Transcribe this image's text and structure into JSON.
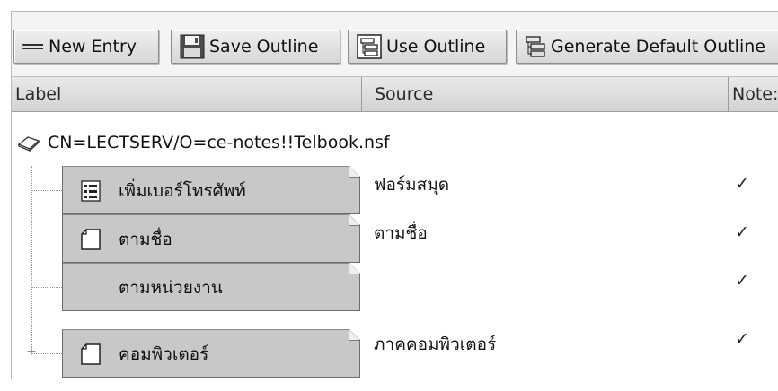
{
  "toolbar": {
    "new_entry": "New Entry",
    "save_outline": "Save Outline",
    "use_outline": "Use Outline",
    "generate_default_outline": "Generate Default Outline"
  },
  "columns": {
    "label": "Label",
    "source": "Source",
    "notes": "Note:"
  },
  "root": {
    "label": "CN=LECTSERV/O=ce-notes!!Telbook.nsf",
    "icon": "database-icon"
  },
  "entries": [
    {
      "label": "เพิ่มเบอร์โทรศัพท์",
      "icon": "form-icon",
      "source": "ฟอร์มสมุด",
      "check": "✓"
    },
    {
      "label": "ตามชื่อ",
      "icon": "page-icon",
      "source": "ตามชื่อ",
      "check": "✓"
    },
    {
      "label": "ตามหน่วยงาน",
      "icon": "",
      "source": "",
      "check": "✓"
    },
    {
      "label": "คอมพิวเตอร์",
      "icon": "page-icon",
      "source": "ภาคคอมพิวเตอร์",
      "check": "✓"
    }
  ]
}
